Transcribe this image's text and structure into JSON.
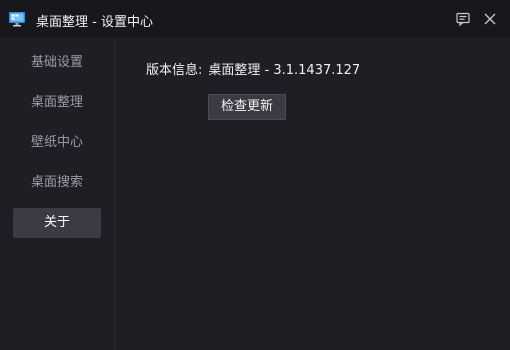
{
  "window": {
    "title": "桌面整理 - 设置中心",
    "app_icon": "desktop-monitor-icon",
    "buttons": {
      "feedback_icon": "feedback-icon",
      "close_icon": "close-icon"
    }
  },
  "sidebar": {
    "items": [
      {
        "label": "基础设置",
        "active": false
      },
      {
        "label": "桌面整理",
        "active": false
      },
      {
        "label": "壁纸中心",
        "active": false
      },
      {
        "label": "桌面搜索",
        "active": false
      },
      {
        "label": "关于",
        "active": true
      }
    ]
  },
  "about": {
    "version_label": "版本信息:",
    "version_value": "桌面整理 - 3.1.1437.127",
    "check_update_label": "检查更新"
  },
  "colors": {
    "background": "#1e1f24",
    "titlebar": "#17181c",
    "active_item": "#3a3b43",
    "text": "#f0f0f0",
    "muted_text": "#9a9ba2"
  }
}
